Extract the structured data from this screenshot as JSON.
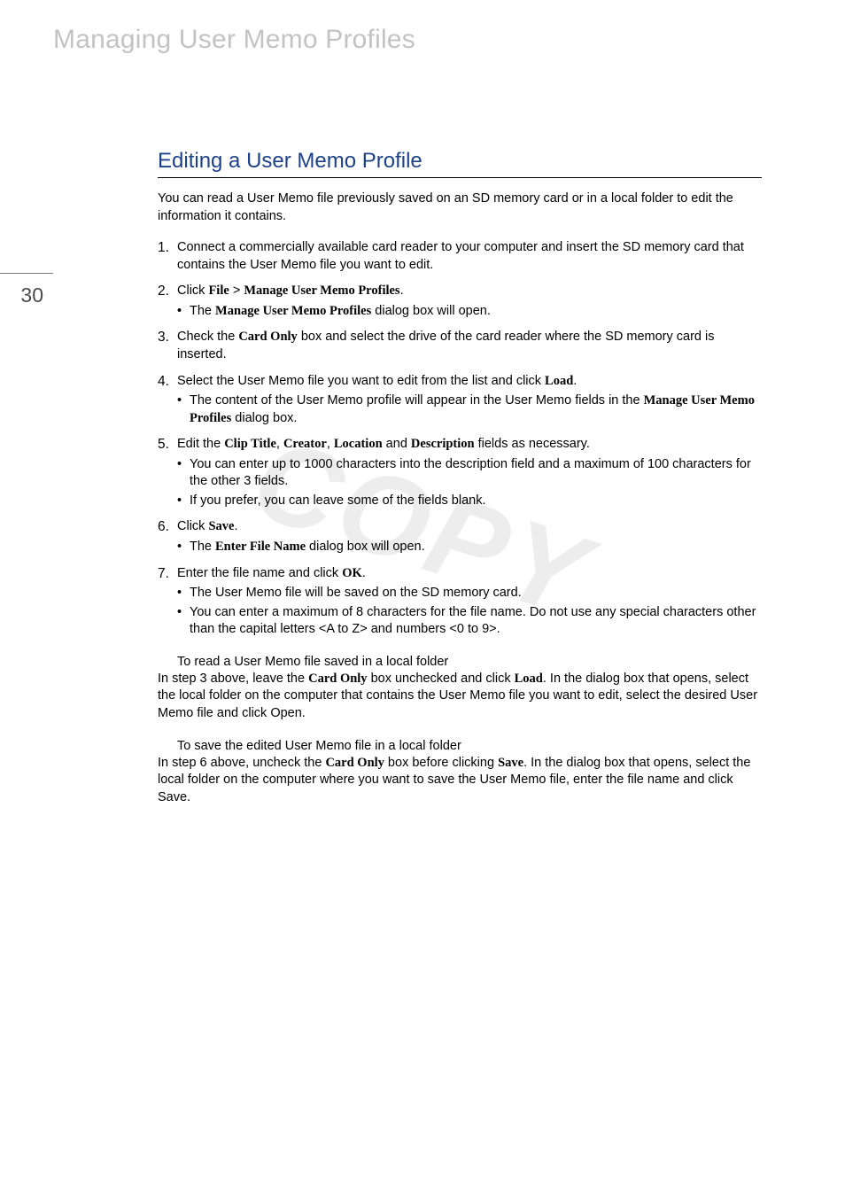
{
  "header": "Managing User Memo Profiles",
  "page_number": "30",
  "watermark": "COPY",
  "section_title": "Editing a User Memo Profile",
  "intro": "You can read a User Memo file previously saved on an SD memory card or in a local folder to edit the information it contains.",
  "steps": {
    "s1": "Connect a commercially available card reader to your computer and insert the SD memory card that contains the User Memo file you want to edit.",
    "s2a": "Click ",
    "s2b": "File",
    "s2c": " > ",
    "s2d": "Manage User Memo Profiles",
    "s2e": ".",
    "s2_b1a": "The ",
    "s2_b1b": "Manage User Memo Profiles",
    "s2_b1c": " dialog box will open.",
    "s3a": "Check the ",
    "s3b": "Card Only",
    "s3c": " box and select the drive of the card reader where the SD memory card is inserted.",
    "s4a": "Select the User Memo file you want to edit from the list and click ",
    "s4b": "Load",
    "s4c": ".",
    "s4_b1a": "The content of the User Memo profile will appear in the User Memo fields in the ",
    "s4_b1b": "Manage User Memo Profiles",
    "s4_b1c": " dialog box.",
    "s5a": "Edit the ",
    "s5b": "Clip Title",
    "s5c": ", ",
    "s5d": "Creator",
    "s5e": ", ",
    "s5f": "Location",
    "s5g": " and ",
    "s5h": "Description",
    "s5i": " fields as necessary.",
    "s5_b1": "You can enter up to 1000 characters into the description field and a maximum of 100 characters for the other 3 fields.",
    "s5_b2": "If you prefer, you can leave some of the fields blank.",
    "s6a": "Click ",
    "s6b": "Save",
    "s6c": ".",
    "s6_b1a": "The ",
    "s6_b1b": "Enter File Name",
    "s6_b1c": " dialog box will open.",
    "s7a": "Enter the file name and click ",
    "s7b": "OK",
    "s7c": ".",
    "s7_b1": "The User Memo file will be saved on the SD memory card.",
    "s7_b2": "You can enter a maximum of 8 characters for the file name. Do not use any special characters other than the capital letters <A to Z> and numbers <0 to 9>."
  },
  "sub1_head": "To read a User Memo file saved in a local folder",
  "sub1a": "In step 3 above, leave the ",
  "sub1b": "Card Only",
  "sub1c": " box unchecked and click ",
  "sub1d": "Load",
  "sub1e": ". In the dialog box that opens, select the local folder on the computer that contains the User Memo file you want to edit, select the desired User Memo file and click Open.",
  "sub2_head": "To save the edited User Memo file in a local folder",
  "sub2a": "In step 6 above, uncheck the ",
  "sub2b": "Card Only",
  "sub2c": " box before clicking ",
  "sub2d": "Save",
  "sub2e": ". In the dialog box that opens, select the local folder on the computer where you want to save the User Memo file, enter the file name and click Save."
}
